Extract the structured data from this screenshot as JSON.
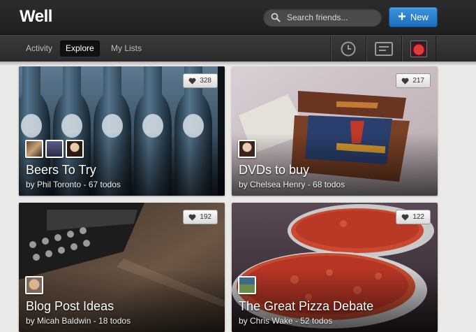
{
  "app": {
    "title": "Well"
  },
  "search": {
    "placeholder": "Search friends..."
  },
  "new_button": {
    "label": "New",
    "icon": "plus-icon"
  },
  "tabs": [
    {
      "label": "Activity",
      "active": false
    },
    {
      "label": "Explore",
      "active": true
    },
    {
      "label": "My Lists",
      "active": false
    }
  ],
  "nav_icons": [
    "clock-icon",
    "message-icon",
    "user-avatar"
  ],
  "lists": [
    {
      "title": "Beers To Try",
      "subtitle": "by Phil Toronto - 67 todos",
      "likes": "328",
      "member_count": 3
    },
    {
      "title": "DVDs to buy",
      "subtitle": "by Chelsea Henry - 68 todos",
      "likes": "217",
      "member_count": 1
    },
    {
      "title": "Blog Post Ideas",
      "subtitle": "by Micah Baldwin - 18 todos",
      "likes": "192",
      "member_count": 1
    },
    {
      "title": "The Great Pizza Debate",
      "subtitle": "by Chris Wake - 52 todos",
      "likes": "122",
      "member_count": 1
    }
  ],
  "colors": {
    "accent": "#2a7fd0",
    "topbar": "#262626",
    "page_bg": "#e9e9e7"
  }
}
